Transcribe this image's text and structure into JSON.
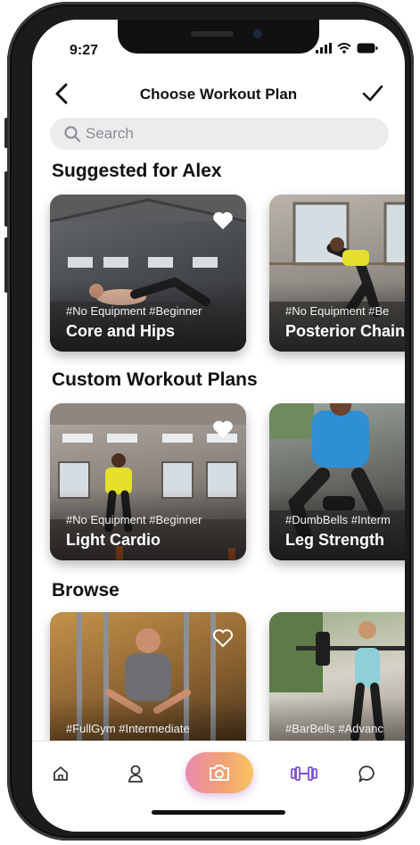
{
  "status_bar": {
    "time": "9:27"
  },
  "nav": {
    "title": "Choose Workout Plan"
  },
  "search": {
    "placeholder": "Search"
  },
  "sections": [
    {
      "title": "Suggested for Alex",
      "cards": [
        {
          "tags": "#No Equipment #Beginner",
          "name": "Core and Hips",
          "favorite": true
        },
        {
          "tags": "#No Equipment #Be",
          "name": "Posterior Chain"
        }
      ]
    },
    {
      "title": "Custom Workout Plans",
      "cards": [
        {
          "tags": "#No Equipment #Beginner",
          "name": "Light Cardio",
          "favorite": true
        },
        {
          "tags": "#DumbBells #Interm",
          "name": "Leg Strength"
        }
      ]
    },
    {
      "title": "Browse",
      "cards": [
        {
          "tags": "#FullGym   #Intermediate",
          "name": "",
          "favorite": false
        },
        {
          "tags": "#BarBells  #Advanc",
          "name": ""
        }
      ]
    }
  ],
  "tabs": [
    "home-icon",
    "profile-icon",
    "camera-icon",
    "dumbbell-icon",
    "chat-icon"
  ],
  "colors": {
    "accent_purple": "#7b4fd6",
    "camera_gradient": [
      "#e98bb0",
      "#f2a274",
      "#f7c45f"
    ],
    "search_bg": "#ececee"
  }
}
